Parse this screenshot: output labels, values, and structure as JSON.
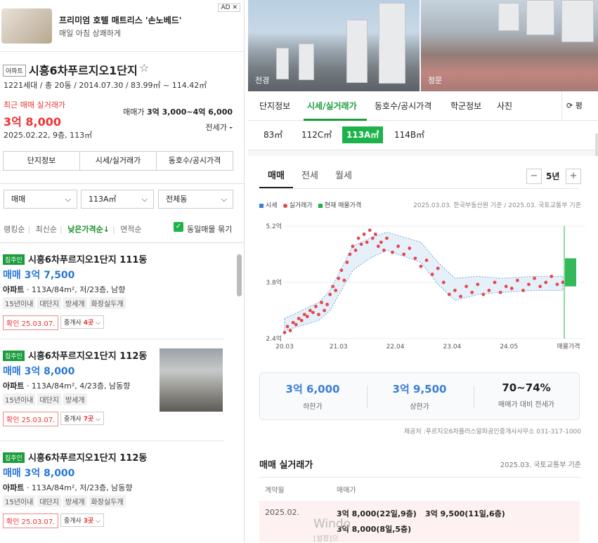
{
  "ad": {
    "title": "프리미엄 호텔 매트리스 '손노베드'",
    "subtitle": "매일 아침 상쾌하게",
    "badge": "AD"
  },
  "complex": {
    "type_badge": "아파트",
    "name": "시흥6차푸르지오1단지",
    "info": "1221세대 / 총 20동 / 2014.07.30 / 83.99㎡ ~ 114.42㎡",
    "recent_label": "최근 매매 실거래가",
    "recent_price": "3억 8,000",
    "recent_date": "2025.02.22, 9층, 113㎡",
    "sale_range_label": "매매가",
    "sale_range_value": "3억 3,000~4억 6,000",
    "jeonse_label": "전세가",
    "jeonse_value": "-"
  },
  "left_tabs": [
    "단지정보",
    "시세/실거래가",
    "동호수/공시가격"
  ],
  "filters": {
    "deal": "매매",
    "area": "113A㎡",
    "dong": "전체동"
  },
  "sorts": [
    "랭킹순",
    "최신순",
    "낮은가격순↓",
    "면적순"
  ],
  "same_merge": "동일매물 묶기",
  "listings": [
    {
      "badge": "집주인",
      "name": "시흥6차푸르지오1단지 111동",
      "price": "매매 3억 7,500",
      "spec_type": "아파트",
      "spec": "113A/84m², 저/23층, 남향",
      "tags": [
        "15년이내",
        "대단지",
        "방세개",
        "화장실두개"
      ],
      "confirm": "확인 25.03.07.",
      "agent_prefix": "중개사",
      "agent_count": "4곳"
    },
    {
      "badge": "집주인",
      "name": "시흥6차푸르지오1단지 112동",
      "price": "매매 3억 8,000",
      "spec_type": "아파트",
      "spec": "113A/84m², 4/23층, 남동향",
      "tags": [
        "15년이내",
        "대단지",
        "방세개"
      ],
      "confirm": "확인 25.03.07.",
      "agent_prefix": "중개사",
      "agent_count": "7곳"
    },
    {
      "badge": "집주인",
      "name": "시흥6차푸르지오1단지 112동",
      "price": "매매 3억 8,000",
      "spec_type": "아파트",
      "spec": "113A/84m², 저/23층, 남동향",
      "tags": [
        "15년이내",
        "대단지",
        "방세개",
        "화장실두개"
      ],
      "confirm": "확인 25.03.07.",
      "agent_prefix": "중개사",
      "agent_count": "3곳"
    }
  ],
  "photos": {
    "left_label": "전경",
    "right_label": "정문"
  },
  "nav_tabs": [
    "단지정보",
    "시세/실거래가",
    "동호수/공시가격",
    "학군정보",
    "사진"
  ],
  "refresh_label": "평",
  "sizes": [
    "83㎡",
    "112C㎡",
    "113A㎡",
    "114B㎡"
  ],
  "chart_tabs": [
    "매매",
    "전세",
    "월세"
  ],
  "year_label": "5년",
  "legend": [
    "시세",
    "실거래가",
    "현재 매물가격"
  ],
  "source_note": "2025.03.03. 한국부동산원 기준 / 2025.03. 국토교통부 기준",
  "colors": {
    "accent": "#1a9e3c",
    "price_blue": "#2a78d6",
    "red": "#e33"
  },
  "chart_data": {
    "type": "scatter",
    "x_ticks": [
      "20.03",
      "21.03",
      "22.04",
      "23.04",
      "24.05",
      "매물가격"
    ],
    "y_ticks": [
      "5.2억",
      "3.8억",
      "2.4억"
    ],
    "ylim": [
      2.4,
      5.2
    ],
    "series": [
      {
        "name": "실거래가",
        "points": [
          [
            2020.2,
            2.55
          ],
          [
            2020.25,
            2.7
          ],
          [
            2020.3,
            2.6
          ],
          [
            2020.35,
            2.8
          ],
          [
            2020.4,
            2.75
          ],
          [
            2020.45,
            2.9
          ],
          [
            2020.5,
            2.85
          ],
          [
            2020.55,
            3.0
          ],
          [
            2020.6,
            2.95
          ],
          [
            2020.65,
            3.1
          ],
          [
            2020.7,
            3.05
          ],
          [
            2020.75,
            3.2
          ],
          [
            2020.8,
            3.0
          ],
          [
            2020.85,
            3.3
          ],
          [
            2020.9,
            3.1
          ],
          [
            2020.95,
            3.25
          ],
          [
            2021.0,
            3.5
          ],
          [
            2021.05,
            3.7
          ],
          [
            2021.1,
            3.6
          ],
          [
            2021.15,
            3.9
          ],
          [
            2021.2,
            4.1
          ],
          [
            2021.25,
            3.85
          ],
          [
            2021.3,
            4.3
          ],
          [
            2021.35,
            4.5
          ],
          [
            2021.4,
            4.7
          ],
          [
            2021.45,
            4.6
          ],
          [
            2021.5,
            4.9
          ],
          [
            2021.55,
            4.75
          ],
          [
            2021.6,
            5.0
          ],
          [
            2021.65,
            4.8
          ],
          [
            2021.7,
            5.1
          ],
          [
            2021.75,
            4.9
          ],
          [
            2021.8,
            5.0
          ],
          [
            2021.85,
            4.7
          ],
          [
            2021.9,
            4.8
          ],
          [
            2021.95,
            4.6
          ],
          [
            2022.0,
            4.9
          ],
          [
            2022.1,
            4.55
          ],
          [
            2022.2,
            4.7
          ],
          [
            2022.3,
            4.5
          ],
          [
            2022.4,
            4.65
          ],
          [
            2022.5,
            4.4
          ],
          [
            2022.6,
            4.2
          ],
          [
            2022.7,
            4.35
          ],
          [
            2022.8,
            4.0
          ],
          [
            2022.9,
            4.15
          ],
          [
            2023.0,
            3.8
          ],
          [
            2023.1,
            3.5
          ],
          [
            2023.2,
            3.6
          ],
          [
            2023.3,
            3.45
          ],
          [
            2023.4,
            3.7
          ],
          [
            2023.5,
            3.55
          ],
          [
            2023.6,
            3.75
          ],
          [
            2023.7,
            3.5
          ],
          [
            2023.8,
            3.6
          ],
          [
            2023.9,
            3.8
          ],
          [
            2024.0,
            3.55
          ],
          [
            2024.1,
            3.7
          ],
          [
            2024.2,
            3.65
          ],
          [
            2024.3,
            3.85
          ],
          [
            2024.4,
            3.6
          ],
          [
            2024.5,
            3.75
          ],
          [
            2024.6,
            3.9
          ],
          [
            2024.7,
            3.7
          ],
          [
            2024.8,
            3.8
          ],
          [
            2024.9,
            3.95
          ],
          [
            2025.0,
            3.75
          ],
          [
            2025.1,
            3.8
          ]
        ]
      },
      {
        "name": "시세",
        "upper": [
          [
            2020.2,
            2.9
          ],
          [
            2020.8,
            3.3
          ],
          [
            2021.0,
            3.6
          ],
          [
            2021.4,
            4.7
          ],
          [
            2021.7,
            4.9
          ],
          [
            2022.0,
            5.05
          ],
          [
            2022.6,
            4.8
          ],
          [
            2022.9,
            4.3
          ],
          [
            2023.2,
            3.9
          ],
          [
            2023.6,
            3.95
          ],
          [
            2024.0,
            3.9
          ],
          [
            2024.6,
            3.95
          ],
          [
            2025.1,
            3.95
          ]
        ],
        "lower": [
          [
            2020.2,
            2.6
          ],
          [
            2020.8,
            2.85
          ],
          [
            2021.0,
            3.1
          ],
          [
            2021.4,
            4.1
          ],
          [
            2021.7,
            4.4
          ],
          [
            2022.0,
            4.6
          ],
          [
            2022.6,
            4.3
          ],
          [
            2022.9,
            3.75
          ],
          [
            2023.2,
            3.35
          ],
          [
            2023.6,
            3.5
          ],
          [
            2024.0,
            3.55
          ],
          [
            2024.6,
            3.6
          ],
          [
            2025.1,
            3.6
          ]
        ]
      },
      {
        "name": "현재 매물가격",
        "range": [
          3.7,
          4.4
        ]
      }
    ]
  },
  "stats": [
    {
      "value": "3억 6,000",
      "label": "하한가"
    },
    {
      "value": "3억 9,500",
      "label": "상한가"
    },
    {
      "value": "70~74%",
      "label": "매매가 대비 전세가"
    }
  ],
  "provider": "제공처 :푸르지오6차플러스알파공인중개사사무소 031-317-1000",
  "deals_section": {
    "title": "매매 실거래가",
    "source": "2025.03. 국토교통부 기준",
    "headers": [
      "계약월",
      "매매가"
    ],
    "row": {
      "month": "2025.02.",
      "d1": "3억 8,000(22일,9층)",
      "d2": "3억 9,500(11일,6층)",
      "d3": "3억 8,000(8일,5층)"
    }
  },
  "watermark": {
    "line1": "Windo",
    "line2": "[설정]으"
  }
}
